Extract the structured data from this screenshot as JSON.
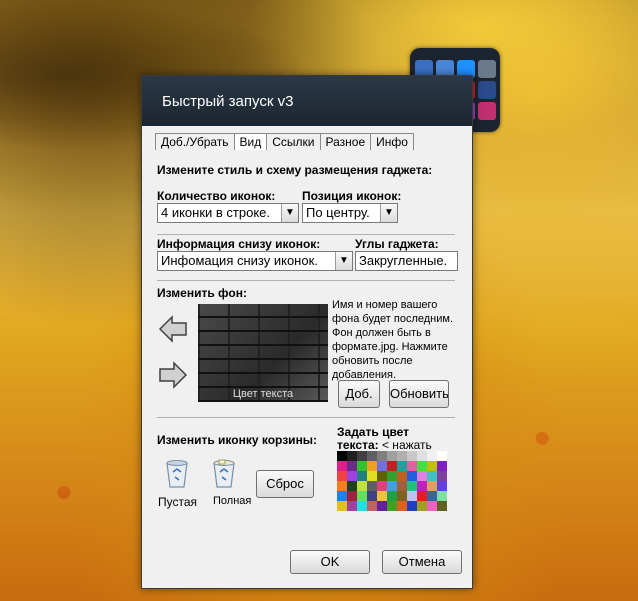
{
  "dialog": {
    "title": "Быстрый запуск v3",
    "tabs": [
      {
        "label": "Доб./Убрать"
      },
      {
        "label": "Вид"
      },
      {
        "label": "Ссылки"
      },
      {
        "label": "Разное"
      },
      {
        "label": "Инфо"
      }
    ],
    "active_tab": "Вид",
    "style_heading": "Измените стиль и схему размещения гаджета:",
    "icon_count_label": "Количество иконок:",
    "icon_count_value": "4 иконки в строке.",
    "icon_position_label": "Позиция иконок:",
    "icon_position_value": "По центру.",
    "info_label": "Информация снизу иконок:",
    "info_value": "Инфомация снизу иконок.",
    "corners_label": "Углы гаджета:",
    "corners_value": "Закругленные.",
    "bg_heading": "Изменить фон:",
    "bg_caption": "Цвет текста",
    "bg_note": [
      "Имя и номер вашего",
      "фона будет последним.",
      "Фон должен быть в",
      "формате.jpg. Нажмите",
      "обновить после",
      "добавления."
    ],
    "add_button": "Доб.",
    "refresh_button": "Обновить",
    "bin_heading": "Изменить иконку корзины:",
    "bin_empty": "Пустая",
    "bin_full": "Полная",
    "reset_button": "Сброс",
    "text_color_heading_1": "Задать цвет",
    "text_color_heading_2": "текста:",
    "text_color_hint": "< нажать",
    "ok_button": "OK",
    "cancel_button": "Отмена"
  },
  "colors": {
    "titlebar": "#1c2630",
    "palette": [
      "#000000",
      "#202020",
      "#404040",
      "#606060",
      "#808080",
      "#a0a0a0",
      "#b0b0b0",
      "#c8c8c8",
      "#e0e0e0",
      "#f0f0f0",
      "#ffffff",
      "#e01c8a",
      "#6a2a8a",
      "#30c030",
      "#f0a020",
      "#7070e0",
      "#c02020",
      "#20a0a0",
      "#e060a0",
      "#40e040",
      "#c0c000",
      "#8020c0",
      "#f04040",
      "#a040e0",
      "#208080",
      "#e0e020",
      "#606000",
      "#30a030",
      "#c06020",
      "#2060e0",
      "#e080e0",
      "#40c0c0",
      "#8040a0",
      "#f08020",
      "#204020",
      "#c0e040",
      "#606060",
      "#e04080",
      "#40a0e0",
      "#a06040",
      "#20c080",
      "#c020c0",
      "#e0a060",
      "#6040e0",
      "#2080f0",
      "#a02040",
      "#60e060",
      "#404080",
      "#f0c040",
      "#20a040",
      "#806020",
      "#c0c0f0",
      "#e02020",
      "#4060a0",
      "#80e0a0",
      "#e0c020",
      "#a040a0",
      "#20e0e0",
      "#c06060",
      "#6020a0",
      "#40a020",
      "#e06020",
      "#2040c0",
      "#a0a020",
      "#f060c0",
      "#606020"
    ]
  }
}
